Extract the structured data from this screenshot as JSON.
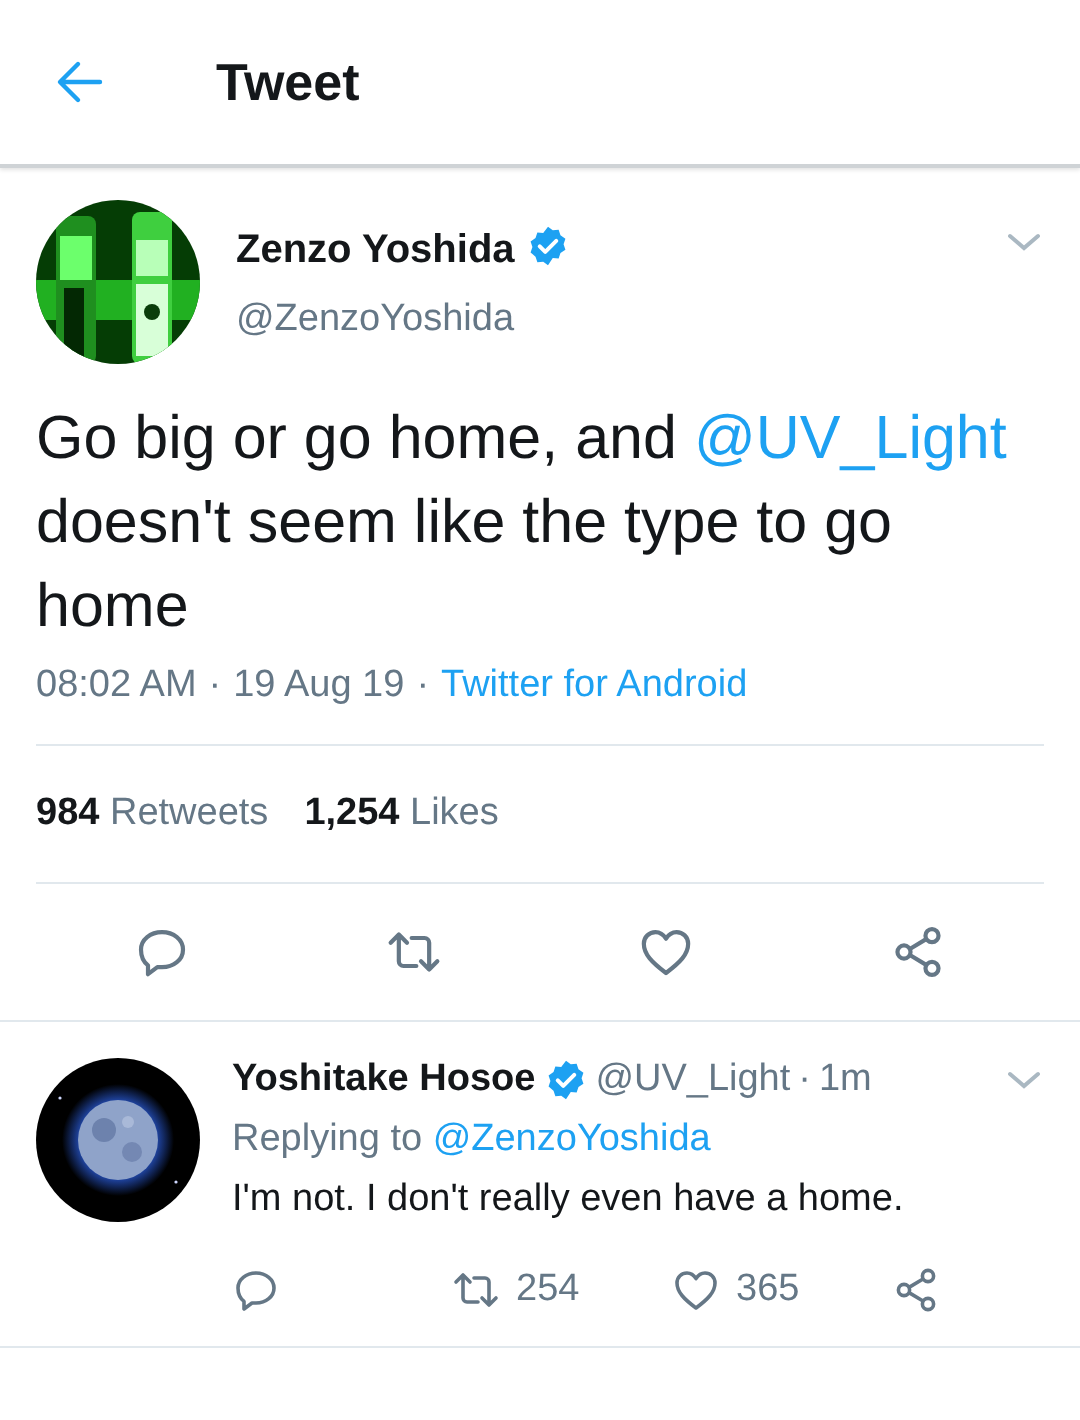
{
  "header": {
    "title": "Tweet"
  },
  "tweet": {
    "author": {
      "name": "Zenzo Yoshida",
      "verified": true,
      "handle": "@ZenzoYoshida"
    },
    "text": {
      "before": "Go big or go home, and ",
      "mention": "@UV_Light",
      "after": " doesn't seem like the type to go home"
    },
    "time": "08:02 AM",
    "date": "19 Aug 19",
    "separator": "·",
    "source": "Twitter for Android",
    "stats": [
      {
        "text": "**984** Retweets"
      },
      {
        "text": "**1,254** Likes"
      }
    ],
    "actions": [
      {
        "kind": "reply"
      },
      {
        "kind": "retweet"
      },
      {
        "kind": "like"
      },
      {
        "kind": "share"
      }
    ]
  },
  "replies": [
    {
      "name": "Yoshitake Hosoe",
      "verified": true,
      "handle": "@UV_Light",
      "separator": "·",
      "time": "1m",
      "replying_label": "Replying to",
      "replying_to": "@ZenzoYoshida",
      "text": "I'm not. I don't really even have a home.",
      "actions": [
        {
          "kind": "reply"
        },
        {
          "kind": "retweet",
          "count": "254"
        },
        {
          "kind": "like",
          "count": "365"
        },
        {
          "kind": "share"
        }
      ]
    }
  ]
}
